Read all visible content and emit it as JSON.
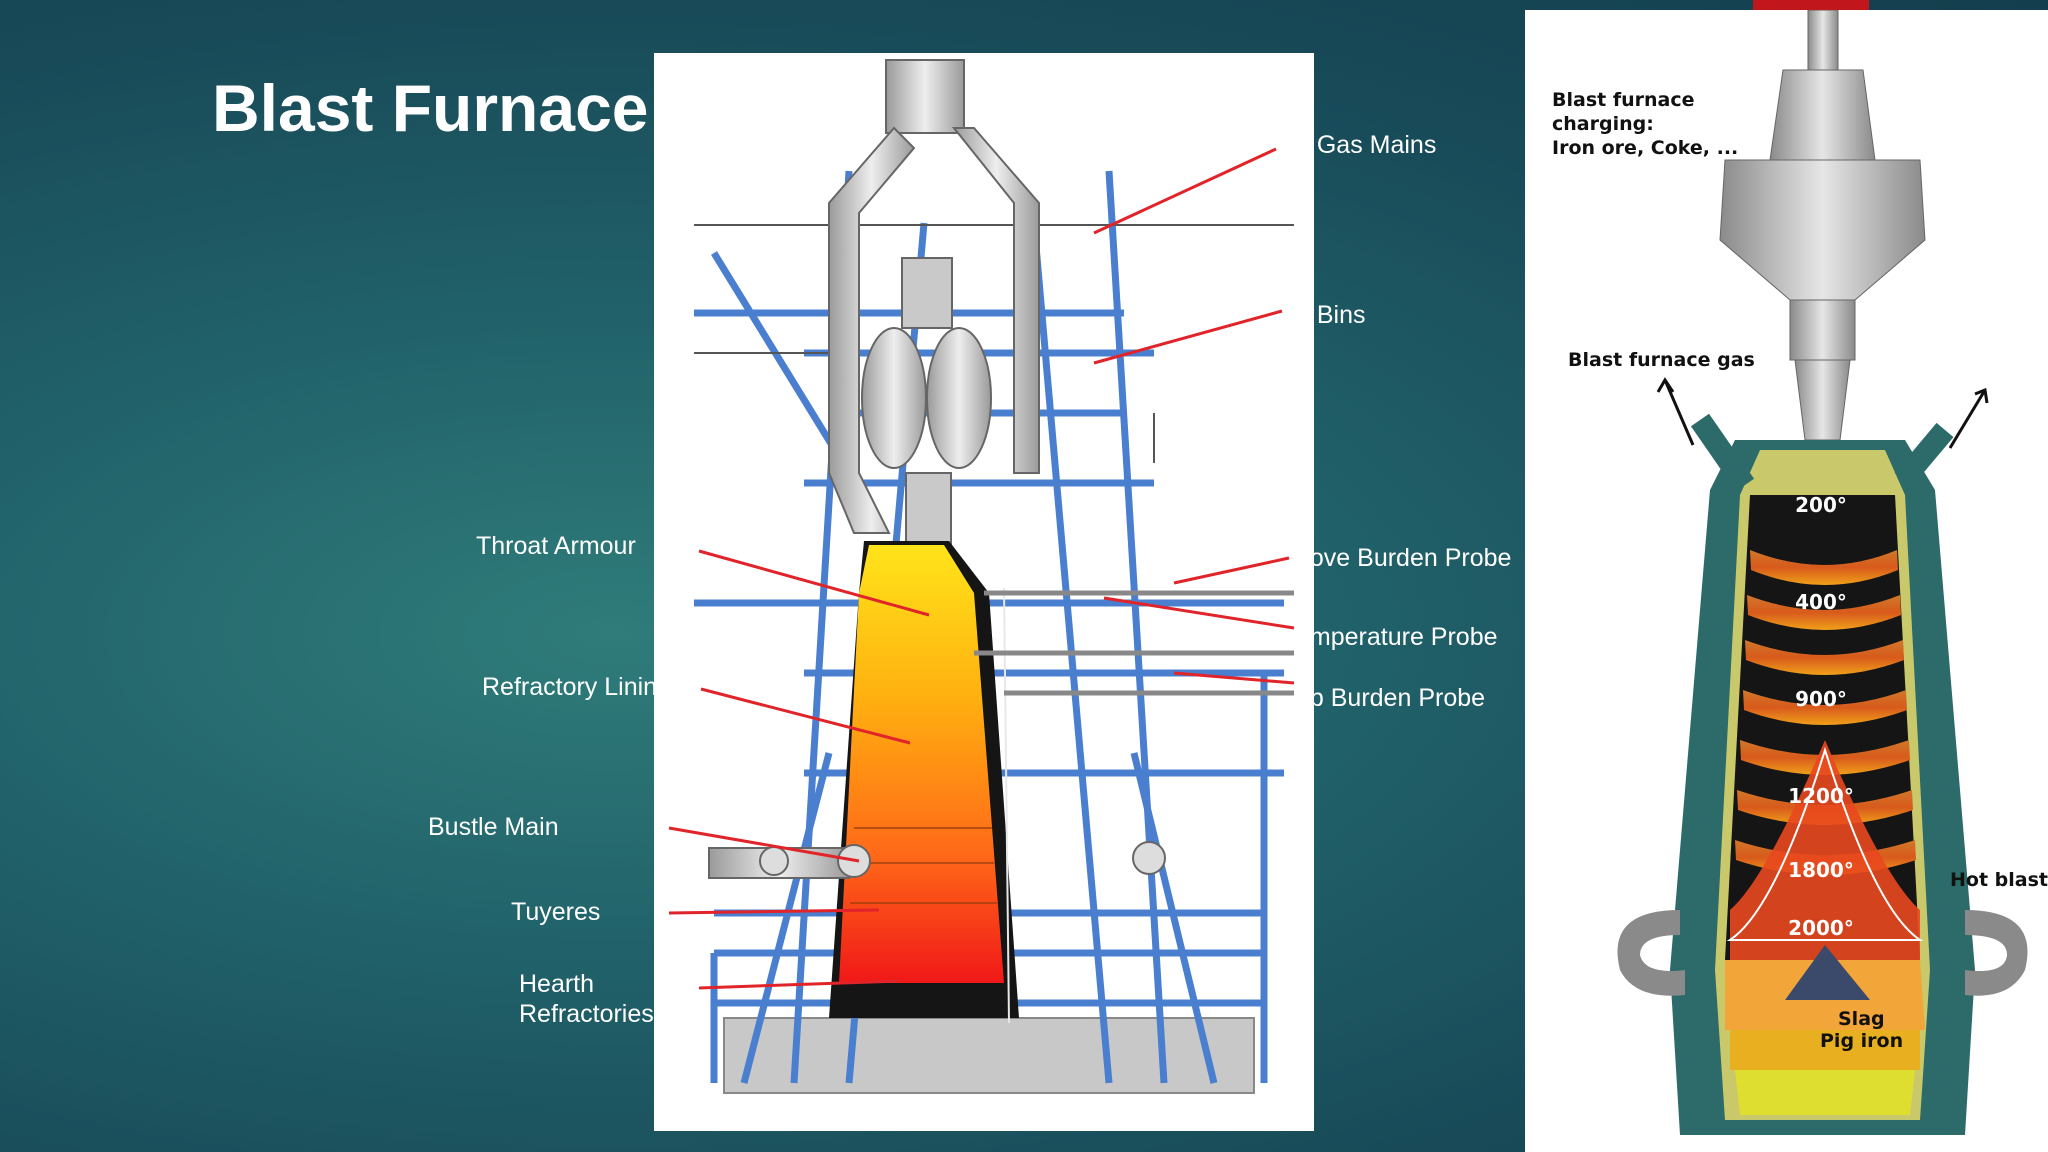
{
  "slide": {
    "title": "Blast Furnace"
  },
  "left_labels": {
    "throat_armour": "Throat Armour",
    "refractory_lining": "Refractory Linin",
    "bustle_main": "Bustle Main",
    "tuyeres": "Tuyeres",
    "hearth_line1": "Hearth",
    "hearth_line2": "Refractories"
  },
  "right_labels": {
    "gas_mains": "o Gas Mains",
    "bins": "p Bins",
    "above_burden_probe": "bove Burden Probe",
    "temperature_probe": "emperature Probe",
    "sub_burden_probe": "ub Burden Probe"
  },
  "profile_diagram": {
    "charging": "Blast furnace\ncharging:\nIron ore, Coke, ...",
    "gas": "Blast furnace gas",
    "hot_blast": "Hot blast",
    "slag": "Slag",
    "pig_iron": "Pig iron",
    "temperatures": [
      "200°",
      "400°",
      "900°",
      "1200°",
      "1800°",
      "2000°"
    ]
  },
  "colors": {
    "annotation_line": "#e0242a",
    "steel_frame": "#4a7fd0",
    "furnace_shell": "#2c6b6a",
    "accent_tab": "#c0161c"
  }
}
